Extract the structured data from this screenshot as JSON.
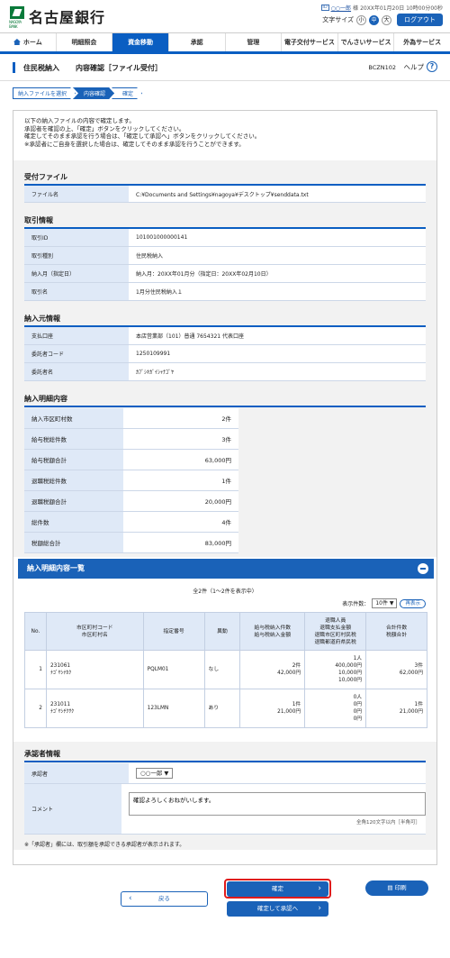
{
  "header": {
    "bank_name": "名古屋銀行",
    "logo_sub": "NAGOYA BANK",
    "user_icon": "ID",
    "user_name": "○○一郎",
    "user_suffix": "様",
    "login_time": "20XX年01月20日 10時00分00秒",
    "font_size_label": "文字サイズ",
    "font_small": "小",
    "font_medium": "中",
    "font_large": "大",
    "logout_label": "ログアウト"
  },
  "nav": [
    {
      "label": "ホーム",
      "active": false
    },
    {
      "label": "明細照会",
      "active": false
    },
    {
      "label": "資金移動",
      "active": true
    },
    {
      "label": "承認",
      "active": false
    },
    {
      "label": "管理",
      "active": false
    },
    {
      "label": "電子交付サービス",
      "active": false
    },
    {
      "label": "でんさいサービス",
      "active": false
    },
    {
      "label": "外為サービス",
      "active": false
    }
  ],
  "page": {
    "title_main": "住民税納入",
    "title_sub": "内容確認［ファイル受付］",
    "screen_id": "BCZN102",
    "help_label": "ヘルプ",
    "help_icon": "?"
  },
  "steps": [
    "納入ファイルを選択",
    "内容確認",
    "確定"
  ],
  "intro": [
    "以下の納入ファイルの内容で確定します。",
    "承認者を確認の上、「確定」ボタンをクリックしてください。",
    "確定してそのまま承認を行う場合は、「確定して承認へ」ボタンをクリックしてください。",
    "※承認者にご自身を選択した場合は、確定してそのまま承認を行うことができます。"
  ],
  "file_section": {
    "title": "受付ファイル",
    "rows": [
      {
        "label": "ファイル名",
        "value": "C:¥Documents and Settings¥nagoya¥デスクトップ¥senddata.txt"
      }
    ]
  },
  "txn_section": {
    "title": "取引情報",
    "rows": [
      {
        "label": "取引ID",
        "value": "101001000000141"
      },
      {
        "label": "取引種別",
        "value": "住民税納入"
      },
      {
        "label": "納入月（指定日）",
        "value": "納入月：20XX年01月分（指定日：20XX年02月10日）"
      },
      {
        "label": "取引名",
        "value": "1月分住民税納入１"
      }
    ]
  },
  "source_section": {
    "title": "納入元情報",
    "rows": [
      {
        "label": "支払口座",
        "value": "本店営業部（101）普通 7654321 代表口座"
      },
      {
        "label": "委託者コード",
        "value": "1250109991"
      },
      {
        "label": "委託者名",
        "value": "ｶﾌﾞｼｷｶﾞｲｼｬﾅｺﾞﾔ"
      }
    ]
  },
  "detail_section": {
    "title": "納入明細内容",
    "rows": [
      {
        "label": "納入市区町村数",
        "value": "2件"
      },
      {
        "label": "給与税総件数",
        "value": "3件"
      },
      {
        "label": "給与税額合計",
        "value": "63,000円"
      },
      {
        "label": "退職税総件数",
        "value": "1件"
      },
      {
        "label": "退職税額合計",
        "value": "20,000円"
      },
      {
        "label": "総件数",
        "value": "4件"
      },
      {
        "label": "税額総合計",
        "value": "83,000円"
      }
    ]
  },
  "list_section": {
    "title": "納入明細内容一覧",
    "count_text": "全2件（1～2件を表示中）",
    "per_page_label": "表示件数：",
    "per_page_value": "10件 ▼",
    "redisplay_label": "再表示",
    "headers": {
      "no": "No.",
      "city": [
        "市区町村コード",
        "市区町村名"
      ],
      "designation": "指定番号",
      "change": "異動",
      "salary": [
        "給与税納入件数",
        "給与税納入金額"
      ],
      "retire": [
        "退職人員",
        "退職支払金額",
        "退職市区町村民税",
        "退職都道府県民税"
      ],
      "total": [
        "合計件数",
        "税額合計"
      ]
    },
    "rows": [
      {
        "no": "1",
        "city_code": "231061",
        "city_name": "ﾅｺﾞﾔｼﾅｶｸ",
        "designation": "PQLM01",
        "change": "なし",
        "salary": [
          "2件",
          "42,000円"
        ],
        "retire": [
          "1人",
          "400,000円",
          "10,000円",
          "10,000円"
        ],
        "total": [
          "3件",
          "62,000円"
        ]
      },
      {
        "no": "2",
        "city_code": "231011",
        "city_name": "ﾅｺﾞﾔｼﾁｸｻｸ",
        "designation": "123LMN",
        "change": "あり",
        "salary": [
          "1件",
          "21,000円"
        ],
        "retire": [
          "0人",
          "0円",
          "0円",
          "0円"
        ],
        "total": [
          "1件",
          "21,000円"
        ]
      }
    ]
  },
  "approver_section": {
    "title": "承認者情報",
    "approver_label": "承認者",
    "approver_value": "○○一郎 ▼",
    "comment_label": "コメント",
    "comment_value": "確認よろしくおねがいします。",
    "comment_limit": "全角120文字以内［半角可］",
    "note": "※「承認者」欄には、取引額を承認できる承認者が表示されます。"
  },
  "buttons": {
    "back": "戻る",
    "confirm": "確定",
    "confirm_approve": "確定して承認へ",
    "print": "印刷"
  },
  "colors": {
    "accent": "#0a5ec2",
    "brand_green": "#0a7a3a",
    "highlight": "#e01b1b"
  }
}
